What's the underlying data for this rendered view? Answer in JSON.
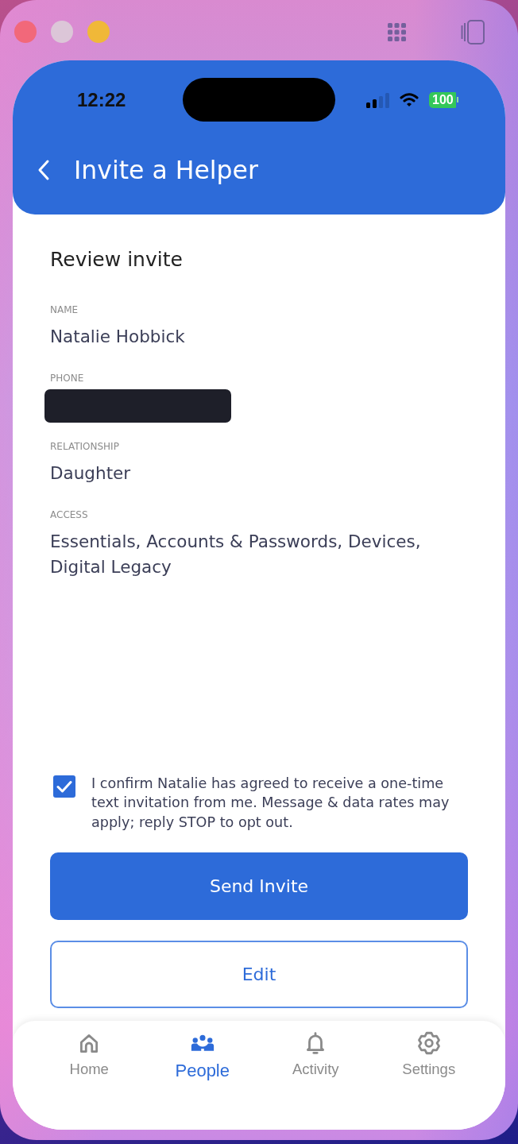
{
  "status_bar": {
    "time": "12:22",
    "battery": "100"
  },
  "header": {
    "title": "Invite a Helper"
  },
  "review": {
    "title": "Review invite",
    "fields": [
      {
        "label": "NAME",
        "value": "Natalie Hobbick",
        "redacted": false
      },
      {
        "label": "PHONE",
        "redacted": true
      },
      {
        "label": "RELATIONSHIP",
        "value": "Daughter",
        "redacted": false
      },
      {
        "label": "ACCESS",
        "value": "Essentials, Accounts & Passwords, Devices, Digital Legacy",
        "redacted": false
      }
    ]
  },
  "consent": {
    "checked": true,
    "text": "I confirm Natalie has agreed to receive a one-time text invitation from me. Message & data rates may apply; reply STOP to opt out."
  },
  "buttons": [
    {
      "label": "Send Invite",
      "kind": "primary"
    },
    {
      "label": "Edit",
      "kind": "secondary"
    }
  ],
  "tab_bar": {
    "tabs": [
      {
        "label": "Home",
        "selected": false
      },
      {
        "label": "People",
        "selected": true
      },
      {
        "label": "Activity",
        "selected": false
      },
      {
        "label": "Settings",
        "selected": false
      }
    ]
  }
}
